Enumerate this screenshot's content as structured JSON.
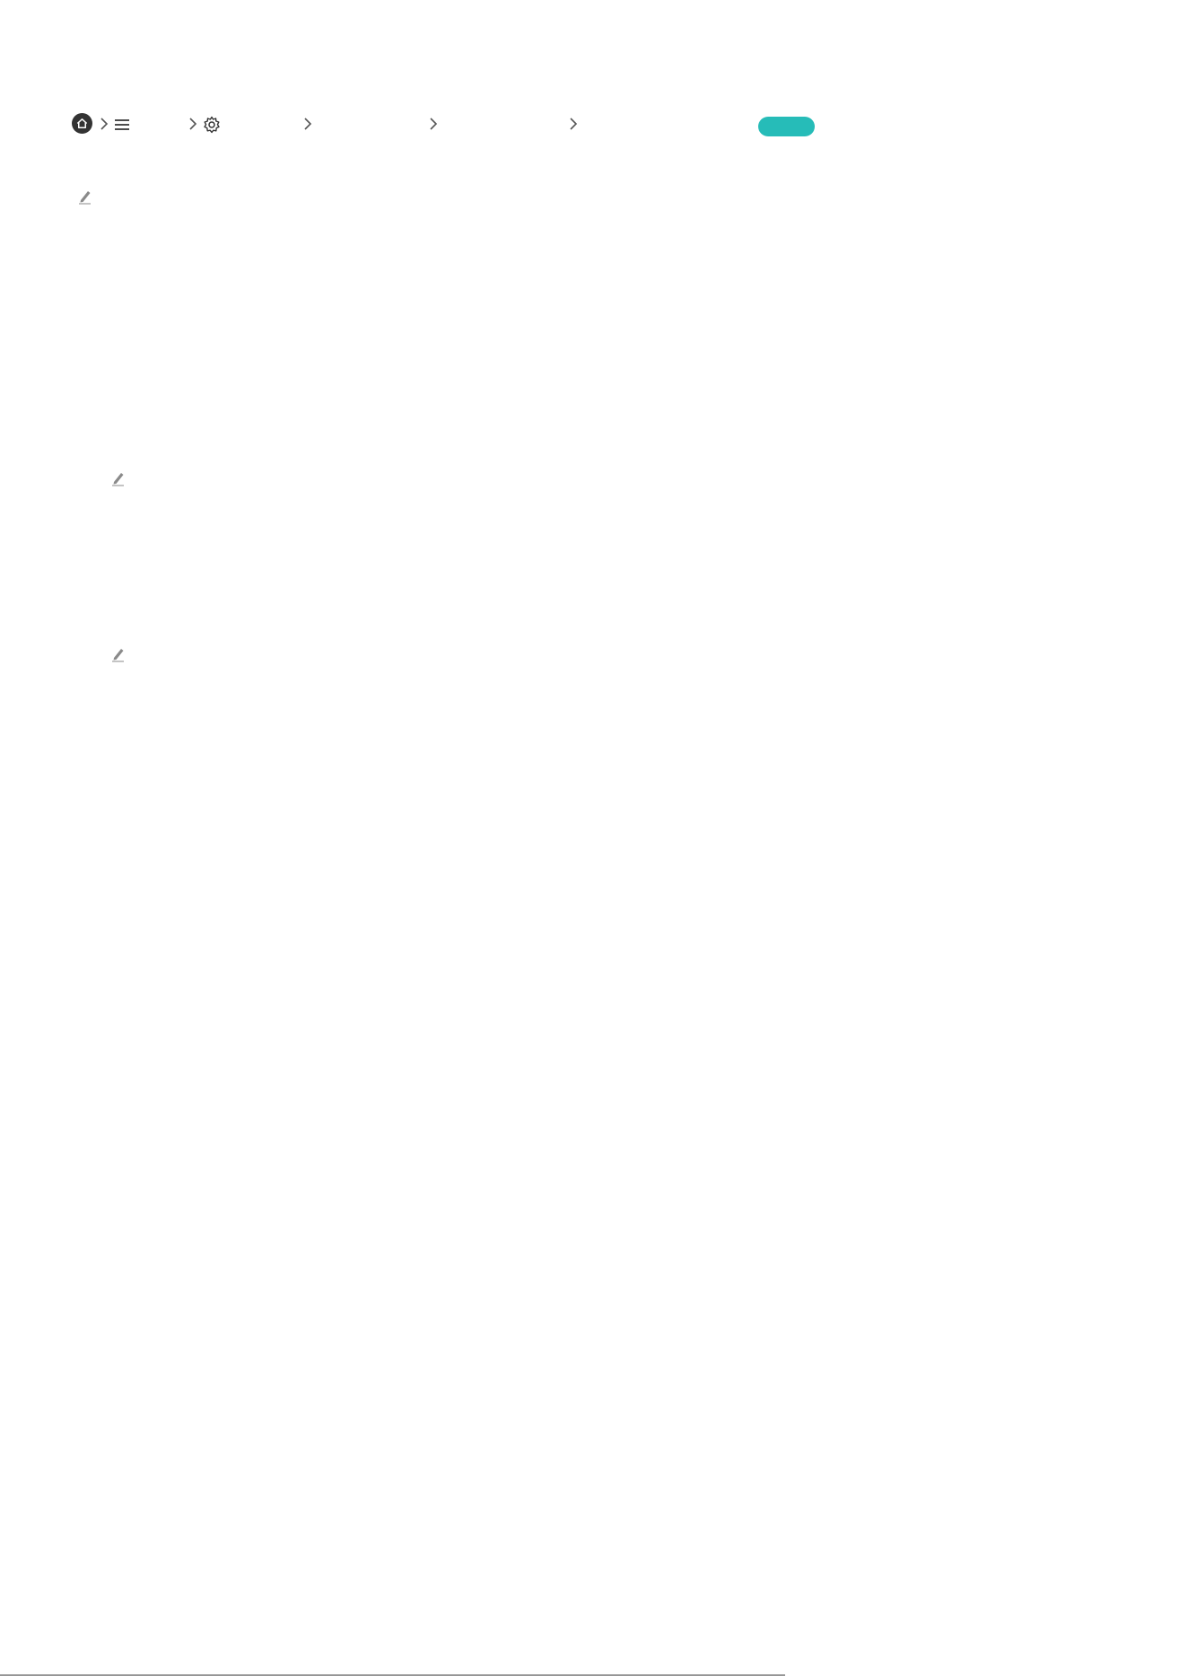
{
  "breadcrumb": {
    "icons": [
      "home-icon",
      "chevron-right-icon",
      "menu-icon",
      "gear-icon",
      "pencil-icon"
    ],
    "try_now_label": ""
  },
  "colors": {
    "accent": "#26BCB8",
    "icon": "#333333",
    "chevron": "#555555"
  },
  "footer": {
    "text": ""
  }
}
